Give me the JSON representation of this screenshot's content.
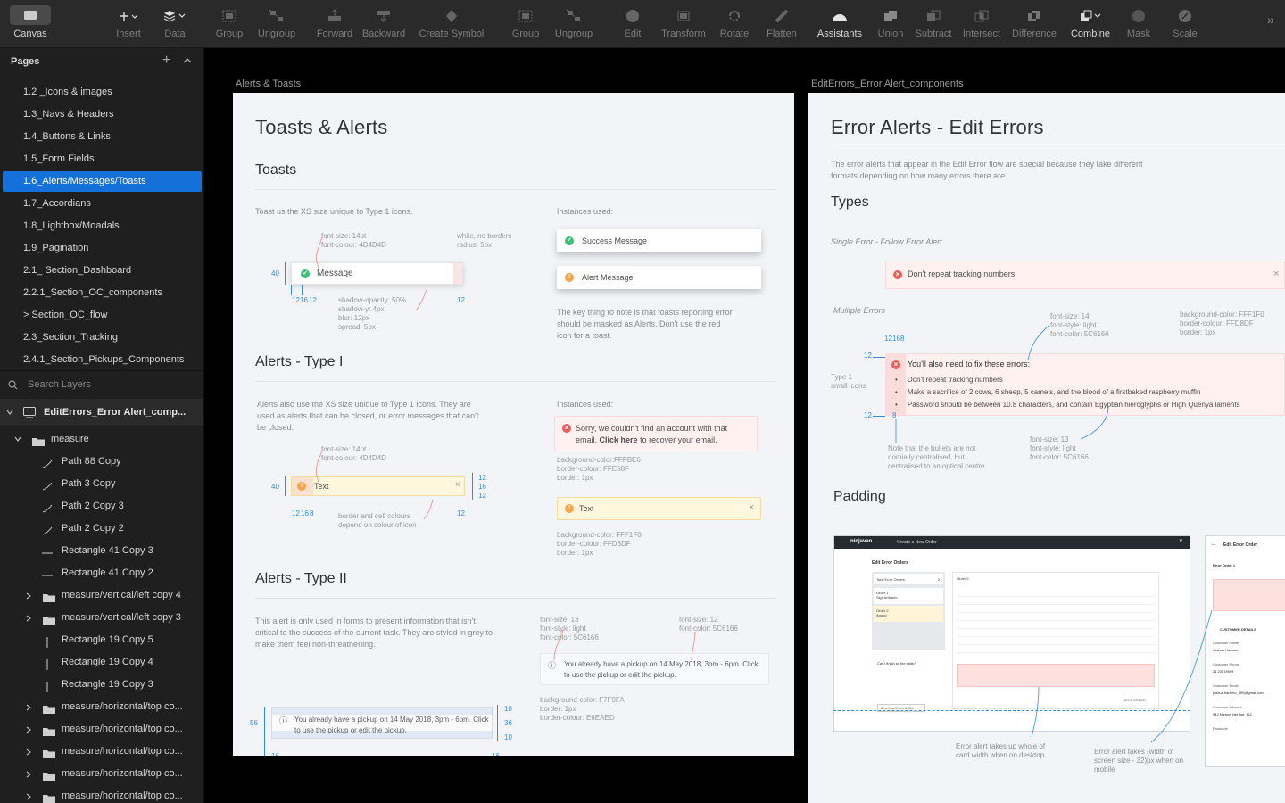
{
  "toolbar": {
    "items": [
      {
        "label": "Canvas",
        "icon": "canvas-icon",
        "active": true
      },
      {
        "label": "Insert",
        "icon": "plus-icon"
      },
      {
        "label": "Data",
        "icon": "data-icon"
      },
      {
        "label": "Group",
        "icon": "group-icon"
      },
      {
        "label": "Ungroup",
        "icon": "ungroup-icon"
      },
      {
        "label": "Forward",
        "icon": "forward-icon"
      },
      {
        "label": "Backward",
        "icon": "backward-icon"
      },
      {
        "label": "Create Symbol",
        "icon": "symbol-icon"
      },
      {
        "label": "Group",
        "icon": "group-icon"
      },
      {
        "label": "Ungroup",
        "icon": "ungroup-icon"
      },
      {
        "label": "Edit",
        "icon": "edit-icon"
      },
      {
        "label": "Transform",
        "icon": "transform-icon"
      },
      {
        "label": "Rotate",
        "icon": "rotate-icon"
      },
      {
        "label": "Flatten",
        "icon": "flatten-icon"
      },
      {
        "label": "Assistants",
        "icon": "assistants-icon",
        "active": true
      },
      {
        "label": "Union",
        "icon": "union-icon"
      },
      {
        "label": "Subtract",
        "icon": "subtract-icon"
      },
      {
        "label": "Intersect",
        "icon": "intersect-icon"
      },
      {
        "label": "Difference",
        "icon": "difference-icon"
      },
      {
        "label": "Combine",
        "icon": "combine-icon",
        "active": true
      },
      {
        "label": "Mask",
        "icon": "mask-icon"
      },
      {
        "label": "Scale",
        "icon": "scale-icon"
      }
    ]
  },
  "sidebar": {
    "pages_title": "Pages",
    "pages": [
      "1.2 _Icons & images",
      "1.3_Navs & Headers",
      "1.4_Buttons & Links",
      "1.5_Form Fields",
      "1.6_Alerts/Messages/Toasts",
      "1.7_Accordians",
      "1.8_Lightbox/Moadals",
      "1.9_Pagination",
      "2.1_ Section_Dashboard",
      "2.2.1_Section_OC_components",
      "> Section_OC_flow",
      "2.3_Section_Tracking",
      "2.4.1_Section_Pickups_Components"
    ],
    "selected_page": 4,
    "search_placeholder": "Search Layers",
    "artboard_layer": "EditErrors_Error Alert_comp...",
    "layers": [
      {
        "name": "measure",
        "type": "folder",
        "indent": 1,
        "expanded": true
      },
      {
        "name": "Path 88 Copy",
        "type": "path",
        "indent": 2
      },
      {
        "name": "Path 3 Copy",
        "type": "path",
        "indent": 2
      },
      {
        "name": "Path 2 Copy 3",
        "type": "path",
        "indent": 2
      },
      {
        "name": "Path 2 Copy 2",
        "type": "path",
        "indent": 2
      },
      {
        "name": "Rectangle 41 Copy 3",
        "type": "line",
        "indent": 2
      },
      {
        "name": "Rectangle 41 Copy 2",
        "type": "line",
        "indent": 2
      },
      {
        "name": "measure/vertical/left copy 4",
        "type": "folder",
        "indent": 2
      },
      {
        "name": "measure/vertical/left copy 3",
        "type": "folder",
        "indent": 2
      },
      {
        "name": "Rectangle 19 Copy 5",
        "type": "vline",
        "indent": 2
      },
      {
        "name": "Rectangle 19 Copy 4",
        "type": "vline",
        "indent": 2
      },
      {
        "name": "Rectangle 19 Copy 3",
        "type": "vline",
        "indent": 2
      },
      {
        "name": "measure/horizontal/top co...",
        "type": "folder",
        "indent": 2
      },
      {
        "name": "measure/horizontal/top co...",
        "type": "folder",
        "indent": 2
      },
      {
        "name": "measure/horizontal/top co...",
        "type": "folder",
        "indent": 2
      },
      {
        "name": "measure/horizontal/top co...",
        "type": "folder",
        "indent": 2
      },
      {
        "name": "measure/horizontal/top co...",
        "type": "folder",
        "indent": 2
      }
    ]
  },
  "artboard_left": {
    "label": "Alerts & Toasts",
    "title": "Toasts & Alerts",
    "toasts_heading": "Toasts",
    "toasts_desc": "Toast us the XS size unique to Type 1 icons.",
    "instances_used": "Instances used:",
    "spec_font": [
      "font-size: 14pt",
      "font-colour: 4D4D4D"
    ],
    "spec_white": [
      "white, no borders",
      "radius: 5px"
    ],
    "toast_label": "Message",
    "spec_shadow": [
      "shadow-opacity: 50%",
      "shadow-y: 4px",
      "blur: 12px",
      "spread: 5px"
    ],
    "success_message": "Success Message",
    "alert_message": "Alert Message",
    "toast_note": "The key thing to note is that toasts reporting error should be masked as Alerts. Don't use the red icon for a toast.",
    "type1_heading": "Alerts - Type I",
    "type1_desc": "Alerts also use the XS size unique to Type 1 icons. They are used as alerts that can be closed, or error messages that can't be closed.",
    "type1_spec_font": [
      "font-size: 14pt",
      "font-colour: 4D4D4D"
    ],
    "type1_text": "Text",
    "type1_border_note": [
      "border and cell colours",
      "depend on colour of icon"
    ],
    "error_alert_text": "Sorry, we couldn't find an account with that email.",
    "error_alert_link": "Click here",
    "error_alert_tail": "to recover your email.",
    "error_spec": [
      "background-color:FFFBE6",
      "border-colour: FFE58F",
      "border: 1px"
    ],
    "warn_alert_text": "Text",
    "warn_spec": [
      "background-color: FFF1F0",
      "border-colour: FFD8DF",
      "border: 1px"
    ],
    "type2_heading": "Alerts - Type II",
    "type2_desc": "This alert is only used in forms to present information that isn't critical to the success of the current task. They are styled in grey to make them feel non-threathening.",
    "type2_spec_a": [
      "font-size: 13",
      "font-style: light",
      "font-color: 5C6166"
    ],
    "type2_spec_b": [
      "font-size: 12",
      "font-color: 5C6166"
    ],
    "type2_text": "You already have a pickup on 14 May 2018, 3pm - 6pm. Click to use the pickup or edit the pickup.",
    "type2_spec_bg": [
      "background-color: F7F9FA",
      "border: 1px",
      "border-colour: E6EAED"
    ],
    "measures": {
      "m40": "40",
      "m12": "12",
      "m16": "16",
      "m8": "8",
      "m56": "56",
      "m10": "10",
      "m36": "36"
    }
  },
  "artboard_right": {
    "label": "EditErrors_Error Alert_components",
    "title": "Error Alerts - Edit Errors",
    "desc": "The error alerts that appear in the Edit Error flow are special because they take different formats depending on how many errors there are",
    "types_heading": "Types",
    "single_label": "Single Error - Follow Error Alert",
    "single_text": "Don't repeat tracking numbers",
    "multiple_label": "Mulitple Errors",
    "spec_top": [
      "font-size: 14",
      "font-style: light",
      "font-color: 5C6166"
    ],
    "spec_bg": [
      "background-color: FFF1F0",
      "border-colour: FFD8DF",
      "border: 1px"
    ],
    "multi_title": "You'll also need to fix these errors:",
    "multi_items": [
      "Don't repeat tracking numbers",
      "Make a sacrifice of 2 cows, 6 sheep, 5 camels, and the blood of a firstbaked raspberry muffin",
      "Password should be between 10.8 characters, and contain Egyptian hieroglyphs or High Quenya laments"
    ],
    "type1_small": [
      "Type 1",
      "small icons"
    ],
    "bullet_note": [
      "Note that the bullets are not",
      "nomially centralised, but",
      "centralised to an optical centre"
    ],
    "spec_bottom": [
      "font-size: 13",
      "font-style: light",
      "font-color: 5C6166"
    ],
    "padding_heading": "Padding",
    "desktop_note": [
      "Error alert takes up whole of",
      "card width when on desktop"
    ],
    "mobile_note": [
      "Error alert takes (width of",
      "screen size - 32)px when on",
      "mobile"
    ],
    "mock": {
      "brand": "ninjavan",
      "create_order": "Create a New Order",
      "edit_error_orders": "Edit Error Orders",
      "total": "Total Error Orders",
      "count": "2",
      "order1": "Order 1",
      "order1_name": "Sigit Ardianto",
      "order2": "Order 2",
      "order2_name": "Anong",
      "fix_title": "Can't finish all the edits?",
      "download": "Download Errors & Quit",
      "next_order": "NEXT ORDER",
      "mobile_title": "Edit Error Order",
      "mobile_order": "Error Order 1",
      "customer_details": "CUSTOMER DETAILS",
      "customer_name_label": "Customer Name",
      "customer_name": "Joshua Hartono",
      "customer_phone_label": "Customer Phone",
      "customer_phone": "21 23519999",
      "customer_email_label": "Customer Email",
      "customer_email": "joshua.hartono_390@gmail.com",
      "customer_address_label": "Customer Address",
      "customer_address": "942 Nienow Isle Apt. 811",
      "postcode_label": "Postcode"
    }
  }
}
